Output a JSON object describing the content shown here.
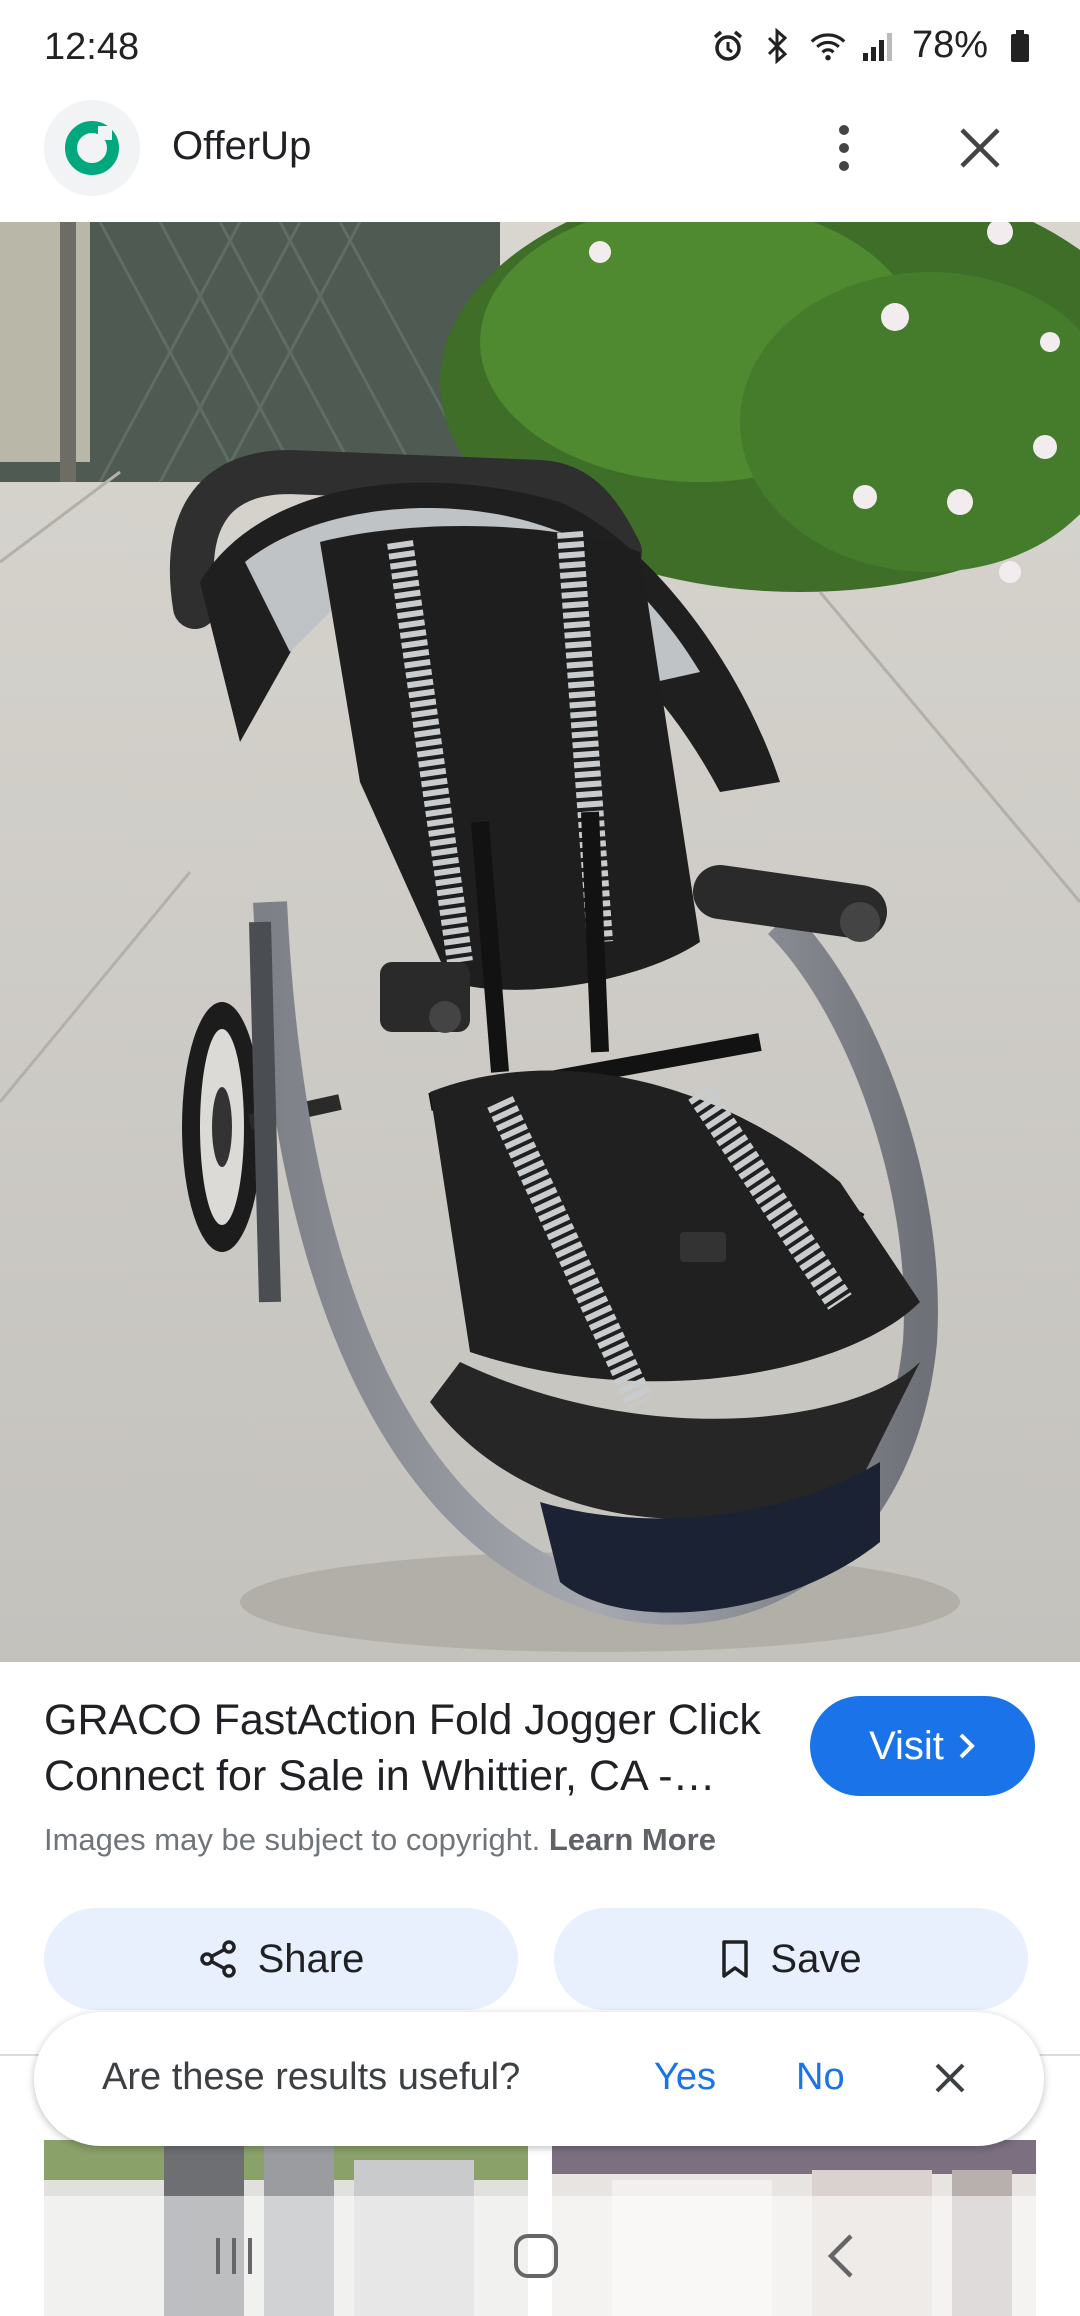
{
  "status_bar": {
    "time": "12:48",
    "battery": "78%",
    "icons": [
      "alarm-icon",
      "bluetooth-icon",
      "wifi-icon",
      "signal-icon",
      "battery-icon"
    ]
  },
  "header": {
    "app_name": "OfferUp",
    "logo_icon": "offerup-logo-icon",
    "more_icon": "more-vert-icon",
    "close_icon": "close-icon"
  },
  "result": {
    "title": "GRACO FastAction Fold Jogger Click Connect for Sale in Whittier, CA - OfferUp",
    "visit_label": "Visit",
    "copyright_text": "Images may be subject to copyright.",
    "learn_more": "Learn More"
  },
  "actions": {
    "share_label": "Share",
    "save_label": "Save"
  },
  "feedback": {
    "question": "Are these results useful?",
    "yes": "Yes",
    "no": "No"
  },
  "colors": {
    "accent": "#1a73e8",
    "action_bg": "#e8f0fe",
    "brand_green": "#00a87e"
  }
}
